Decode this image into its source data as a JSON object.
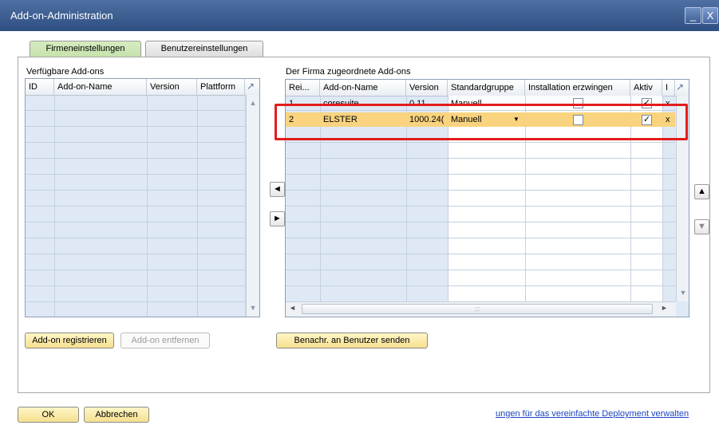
{
  "window": {
    "title": "Add-on-Administration",
    "minimize": "_",
    "close": "X"
  },
  "tabs": [
    {
      "label": "Firmeneinstellungen"
    },
    {
      "label": "Benutzereinstellungen"
    }
  ],
  "available": {
    "title": "Verfügbare Add-ons",
    "columns": [
      "ID",
      "Add-on-Name",
      "Version",
      "Plattform"
    ]
  },
  "assigned": {
    "title": "Der Firma zugeordnete Add-ons",
    "columns": [
      "Rei...",
      "Add-on-Name",
      "Version",
      "Standardgruppe",
      "Installation erzwingen",
      "Aktiv",
      "I"
    ],
    "rows": [
      {
        "idx": "1",
        "name": "coresuite",
        "version": "0.11",
        "group": "Manuell",
        "active": "✓",
        "extra": "x"
      },
      {
        "idx": "2",
        "name": "ELSTER",
        "version": "1000.24(",
        "group": "Manuell",
        "active": "✓",
        "extra": "x"
      }
    ]
  },
  "buttons": {
    "register": "Add-on registrieren",
    "remove": "Add-on entfernen",
    "notify": "Benachr. an Benutzer senden",
    "ok": "OK",
    "cancel": "Abbrechen"
  },
  "link": "ungen für das vereinfachte Deployment verwalten",
  "icons": {
    "left": "◄",
    "right": "►",
    "up": "▲",
    "down": "▼",
    "corner": "↗",
    "dropdown": "▼",
    "scroll_grip": ":::"
  }
}
